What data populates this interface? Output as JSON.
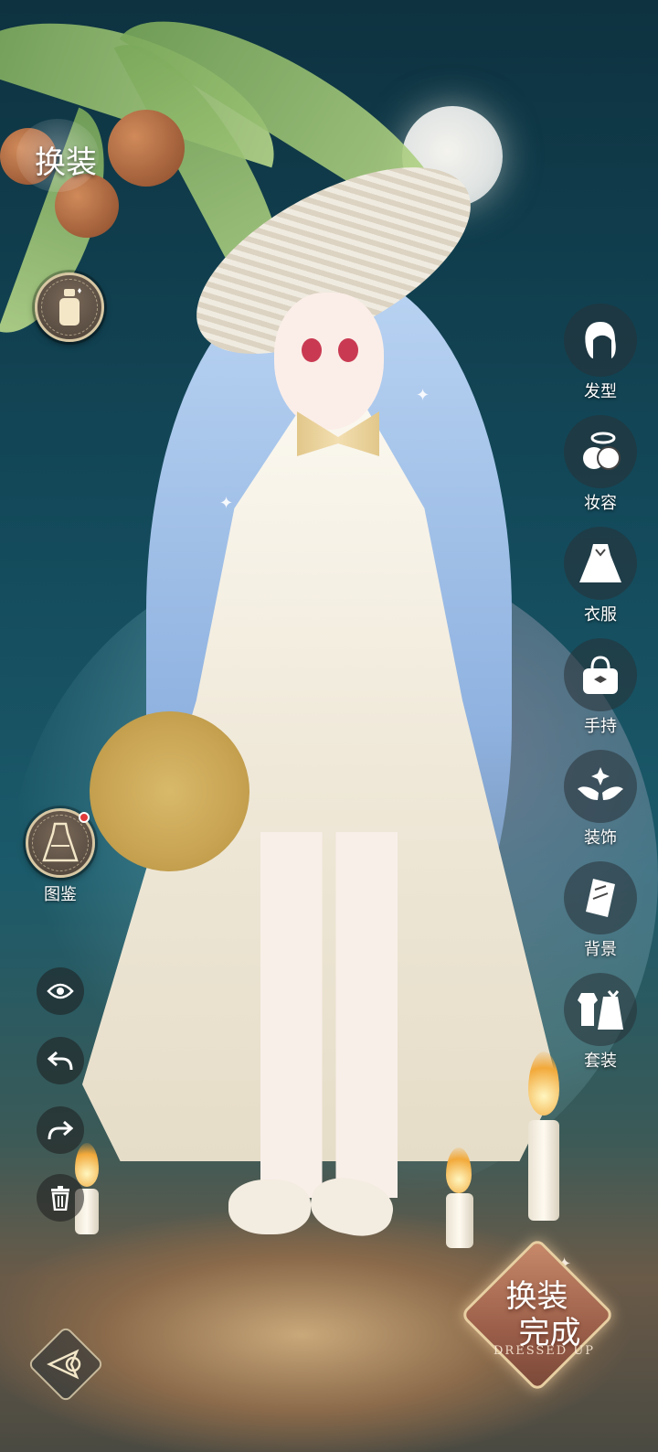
{
  "header": {
    "title": "换装"
  },
  "left_tools": {
    "cosmetics_icon": "bottle-icon",
    "codex_label": "图鉴",
    "codex_badge": "red-dot",
    "actions": [
      {
        "name": "eye",
        "icon": "eye-icon"
      },
      {
        "name": "undo",
        "icon": "undo-icon"
      },
      {
        "name": "redo",
        "icon": "redo-icon"
      },
      {
        "name": "delete",
        "icon": "trash-icon"
      }
    ]
  },
  "side_menu": {
    "items": [
      {
        "label": "发型",
        "icon": "hairstyle-icon"
      },
      {
        "label": "妆容",
        "icon": "makeup-icon"
      },
      {
        "label": "衣服",
        "icon": "dress-icon"
      },
      {
        "label": "手持",
        "icon": "handbag-icon"
      },
      {
        "label": "装饰",
        "icon": "wings-icon"
      },
      {
        "label": "背景",
        "icon": "background-icon"
      },
      {
        "label": "套装",
        "icon": "outfit-set-icon"
      }
    ]
  },
  "footer": {
    "done_line1": "换装",
    "done_line2": "完成",
    "done_sub": "DRESSED UP",
    "back_icon": "back-arrow-icon"
  },
  "colors": {
    "accent_gold": "#d7c7a3",
    "done_button": "#9b5e49",
    "badge_red": "#e23a3a"
  }
}
